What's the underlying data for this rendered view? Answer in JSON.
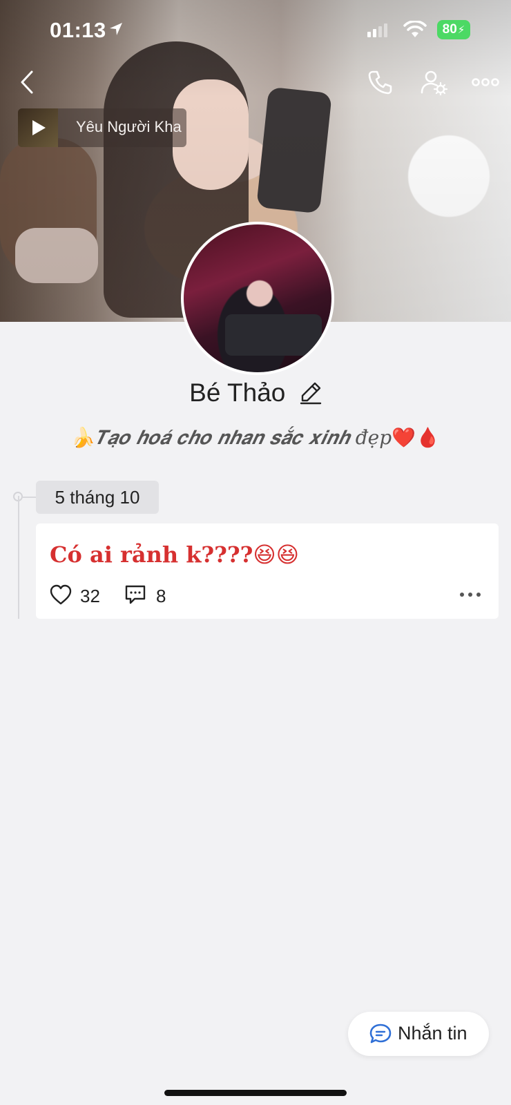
{
  "status_bar": {
    "time": "01:13",
    "battery": "80"
  },
  "header": {
    "back_icon": "chevron-left-icon",
    "call_icon": "phone-icon",
    "settings_icon": "user-settings-icon",
    "more_icon": "more-horizontal-icon"
  },
  "music": {
    "title": "Yêu Người Kha"
  },
  "profile": {
    "name": "Bé Thảo",
    "bio_emoji_start": "🍌",
    "bio_text": "𝑻𝒂̣𝒐 𝒉𝒐𝒂́ 𝒄𝒉𝒐 𝒏𝒉𝒂𝒏 𝒔𝒂̆́𝒄 𝒙𝒊𝒏𝒉 đẹp",
    "bio_emoji_end": "❤️🩸"
  },
  "timeline": {
    "date": "5 tháng 10"
  },
  "post": {
    "text": "Có ai rảnh k????",
    "emojis": "😆😆",
    "likes": "32",
    "comments": "8"
  },
  "message_button": {
    "label": "Nhắn tin"
  },
  "colors": {
    "post_text": "#d63030",
    "battery": "#4cd964",
    "chat_icon": "#2f6fd6",
    "background": "#f2f2f4"
  }
}
